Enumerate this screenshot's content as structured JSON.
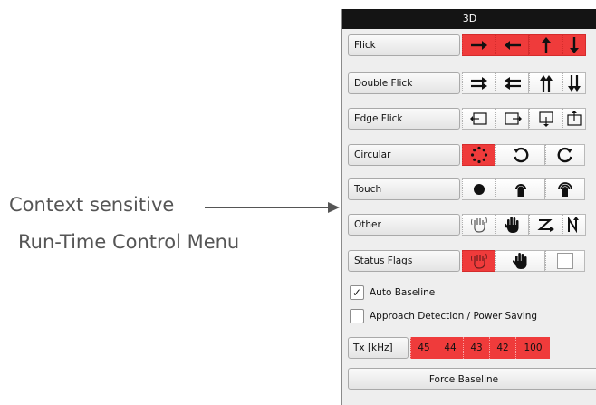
{
  "annotation": {
    "line1": "Context sensitive",
    "line2": "Run-Time Control Menu"
  },
  "panel": {
    "title": "3D",
    "rows": [
      {
        "label": "Flick",
        "icons": [
          "arrow-right-icon",
          "arrow-left-icon",
          "arrow-up-icon",
          "arrow-down-icon"
        ],
        "active": [
          true,
          true,
          true,
          true
        ]
      },
      {
        "label": "Double Flick",
        "icons": [
          "double-arrow-right-icon",
          "double-arrow-left-icon",
          "double-arrow-up-icon",
          "double-arrow-down-icon"
        ],
        "active": [
          false,
          false,
          false,
          false
        ]
      },
      {
        "label": "Edge Flick",
        "icons": [
          "edge-flick-left-icon",
          "edge-flick-right-icon",
          "edge-flick-down-icon",
          "edge-flick-up-icon"
        ],
        "active": [
          false,
          false,
          false,
          false
        ]
      },
      {
        "label": "Circular",
        "icons": [
          "dotted-circle-icon",
          "rotate-clockwise-icon",
          "rotate-counterclockwise-icon"
        ],
        "active": [
          true,
          false,
          false
        ]
      },
      {
        "label": "Touch",
        "icons": [
          "touch-dot-icon",
          "touch-tap-icon",
          "touch-hold-icon"
        ],
        "active": [
          false,
          false,
          false
        ]
      },
      {
        "label": "Other",
        "icons": [
          "hand-outline-icon",
          "hand-filled-icon",
          "z-gesture-icon",
          "n-gesture-icon"
        ],
        "active": [
          false,
          false,
          false,
          false
        ]
      },
      {
        "label": "Status Flags",
        "icons": [
          "hand-outline-icon",
          "hand-filled-icon",
          "empty-square-icon"
        ],
        "active": [
          true,
          false,
          false
        ]
      }
    ],
    "checkboxes": [
      {
        "label": "Auto Baseline",
        "checked": true
      },
      {
        "label": "Approach Detection / Power Saving",
        "checked": false
      }
    ],
    "tx": {
      "label": "Tx [kHz]",
      "values": [
        "45",
        "44",
        "43",
        "42",
        "100"
      ]
    },
    "force_button": "Force Baseline"
  },
  "colors": {
    "active": "#ef3b3b",
    "titlebar": "#141414",
    "panel_bg": "#eeeeee"
  }
}
